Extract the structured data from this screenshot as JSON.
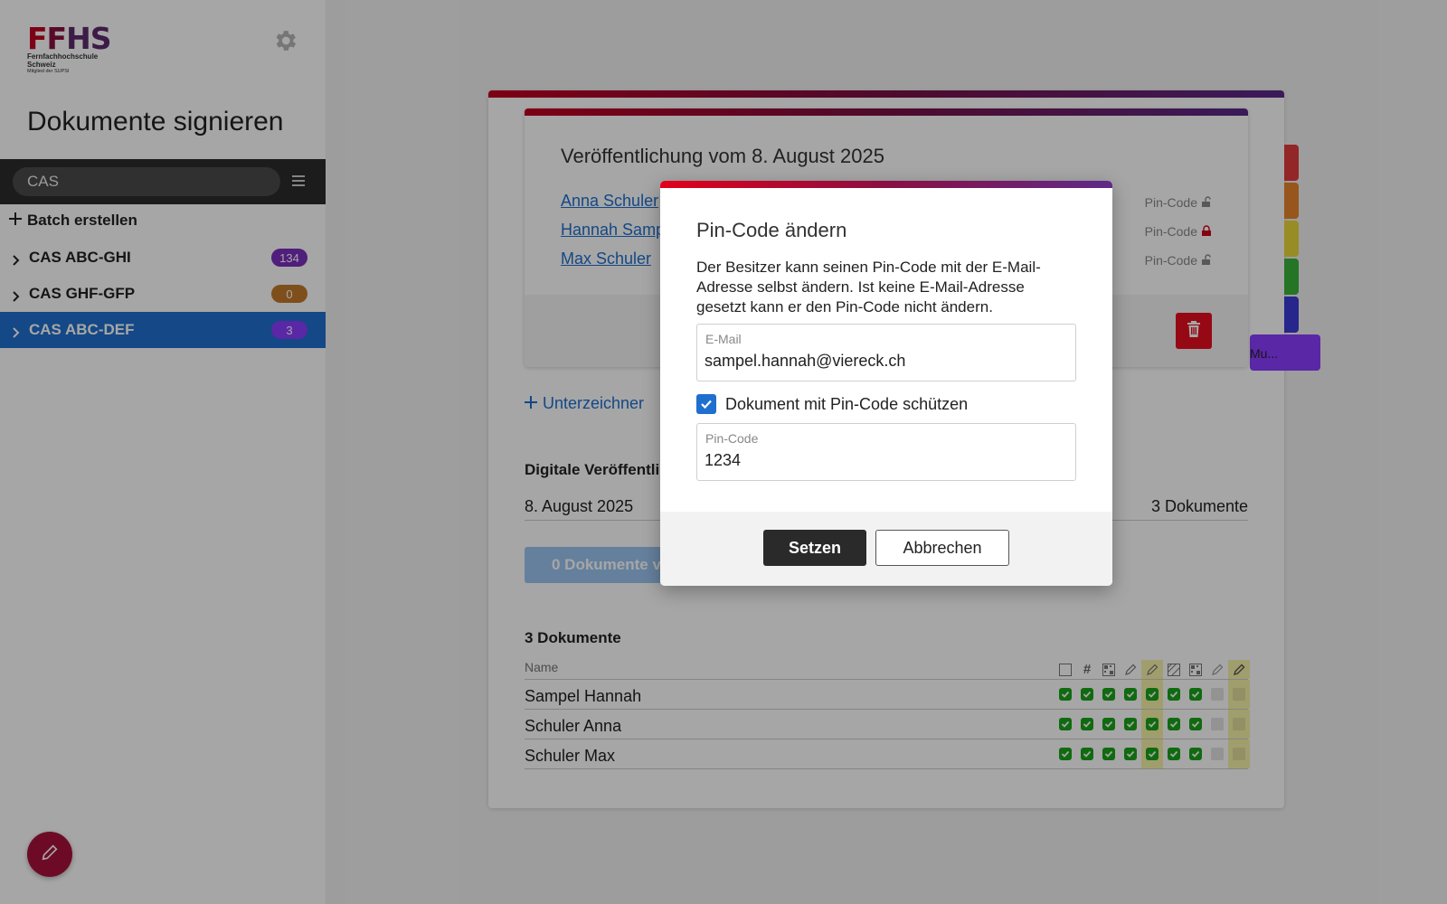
{
  "sidebar": {
    "logo": {
      "mark": "FFHS",
      "line1": "Fernfachhochschule",
      "line2": "Schweiz",
      "line3": "Mitglied der SUPSI"
    },
    "title": "Dokumente signieren",
    "search": {
      "value": "CAS"
    },
    "batch_action": "Batch erstellen",
    "items": [
      {
        "label": "CAS ABC-GHI",
        "count": "134",
        "badge_color": "#7b2fbe"
      },
      {
        "label": "CAS GHF-GFP",
        "count": "0",
        "badge_color": "#c47a2a"
      },
      {
        "label": "CAS ABC-DEF",
        "count": "3",
        "badge_color": "#8b3dff"
      }
    ]
  },
  "publication": {
    "title": "Veröffentlichung vom 8. August 2025",
    "signers": [
      {
        "name": "Anna Schuler",
        "pin": "Pin-Code",
        "locked": false
      },
      {
        "name": "Hannah Sampel",
        "pin": "Pin-Code",
        "locked": true
      },
      {
        "name": "Max Schuler",
        "pin": "Pin-Code",
        "locked": false
      }
    ]
  },
  "add_signer": "Unterzeichner",
  "digital": {
    "title": "Digitale Veröffentlichung",
    "date": "8. August 2025",
    "count": "3 Dokumente",
    "button": "0 Dokumente veröffentlichen"
  },
  "tab_more_label": "Mu...",
  "tab_colors": [
    "#e23b3b",
    "#e8852a",
    "#e8d83a",
    "#3bb33b",
    "#3b3bd8"
  ],
  "documents": {
    "title": "3 Dokumente",
    "name_header": "Name",
    "rows": [
      {
        "name": "Sampel Hannah"
      },
      {
        "name": "Schuler Anna"
      },
      {
        "name": "Schuler Max"
      }
    ]
  },
  "modal": {
    "title": "Pin-Code ändern",
    "description": "Der Besitzer kann seinen Pin-Code mit der E-Mail-Adresse selbst ändern. Ist keine E-Mail-Adresse gesetzt kann er den Pin-Code nicht ändern.",
    "email_label": "E-Mail",
    "email_value": "sampel.hannah@viereck.ch",
    "checkbox_label": "Dokument mit Pin-Code schützen",
    "pin_label": "Pin-Code",
    "pin_value": "1234",
    "confirm": "Setzen",
    "cancel": "Abbrechen"
  },
  "colors": {
    "accent": "#1f6fce",
    "danger": "#e60f1f",
    "success": "#1aa41a"
  }
}
